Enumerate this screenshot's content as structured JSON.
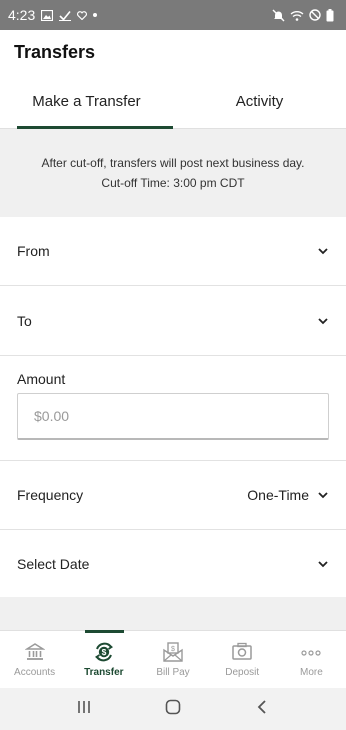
{
  "status_bar": {
    "time": "4:23",
    "left_icons": [
      "gallery-icon",
      "check-icon",
      "heart-icon",
      "dot-icon"
    ],
    "right_icons": [
      "mute-icon",
      "wifi-icon",
      "do-not-disturb-icon",
      "battery-icon"
    ]
  },
  "header": {
    "title": "Transfers"
  },
  "tabs": [
    {
      "label": "Make a Transfer",
      "active": true
    },
    {
      "label": "Activity",
      "active": false
    }
  ],
  "notice": {
    "line1": "After cut-off, transfers will post next business day.",
    "line2": "Cut-off Time: 3:00 pm CDT"
  },
  "form": {
    "from_label": "From",
    "to_label": "To",
    "amount_label": "Amount",
    "amount_placeholder": "$0.00",
    "frequency_label": "Frequency",
    "frequency_value": "One-Time",
    "date_label": "Select Date"
  },
  "bottom_nav": [
    {
      "label": "Accounts",
      "icon": "bank-icon",
      "active": false
    },
    {
      "label": "Transfer",
      "icon": "transfer-dollar-icon",
      "active": true
    },
    {
      "label": "Bill Pay",
      "icon": "bill-envelope-icon",
      "active": false
    },
    {
      "label": "Deposit",
      "icon": "camera-icon",
      "active": false
    },
    {
      "label": "More",
      "icon": "more-dots-icon",
      "active": false
    }
  ],
  "colors": {
    "accent": "#1d4a32",
    "status_bar": "#7a7a7a",
    "inactive": "#9a9a9a",
    "panel": "#f0f0f0"
  }
}
